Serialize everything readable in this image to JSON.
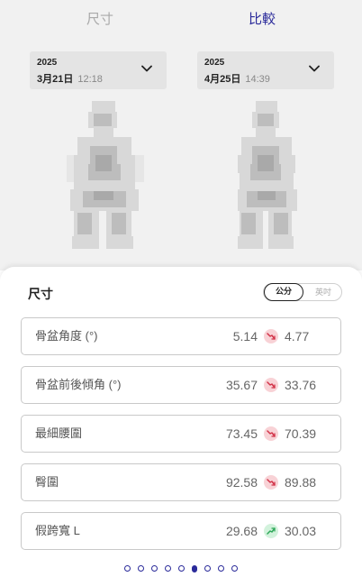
{
  "tabs": {
    "size": "尺寸",
    "compare": "比較"
  },
  "dates": {
    "left": {
      "year": "2025",
      "day": "3月21日",
      "time": "12:18"
    },
    "right": {
      "year": "2025",
      "day": "4月25日",
      "time": "14:39"
    }
  },
  "measurements": {
    "title": "尺寸",
    "units": {
      "cm": "公分",
      "inch": "英吋",
      "selected": "cm"
    },
    "rows": [
      {
        "label": "骨盆角度 (°)",
        "before": "5.14",
        "trend": "down",
        "after": "4.77"
      },
      {
        "label": "骨盆前後傾角 (°)",
        "before": "35.67",
        "trend": "down",
        "after": "33.76"
      },
      {
        "label": "最細腰圍",
        "before": "73.45",
        "trend": "down",
        "after": "70.39"
      },
      {
        "label": "臀圍",
        "before": "92.58",
        "trend": "down",
        "after": "89.88"
      },
      {
        "label": "假跨寬 L",
        "before": "29.68",
        "trend": "up",
        "after": "30.03"
      }
    ]
  },
  "icons": {
    "chevron": "chevron-down-icon",
    "trend_down": "trend-down-icon",
    "trend_up": "trend-up-icon"
  },
  "colors": {
    "accent": "#2a2a9a",
    "down_badge": "#f8d2d6",
    "down_arrow": "#d2354a",
    "up_badge": "#d2f2dc",
    "up_arrow": "#2fa85a"
  },
  "pagination": {
    "count": 9,
    "active_index": 5
  }
}
